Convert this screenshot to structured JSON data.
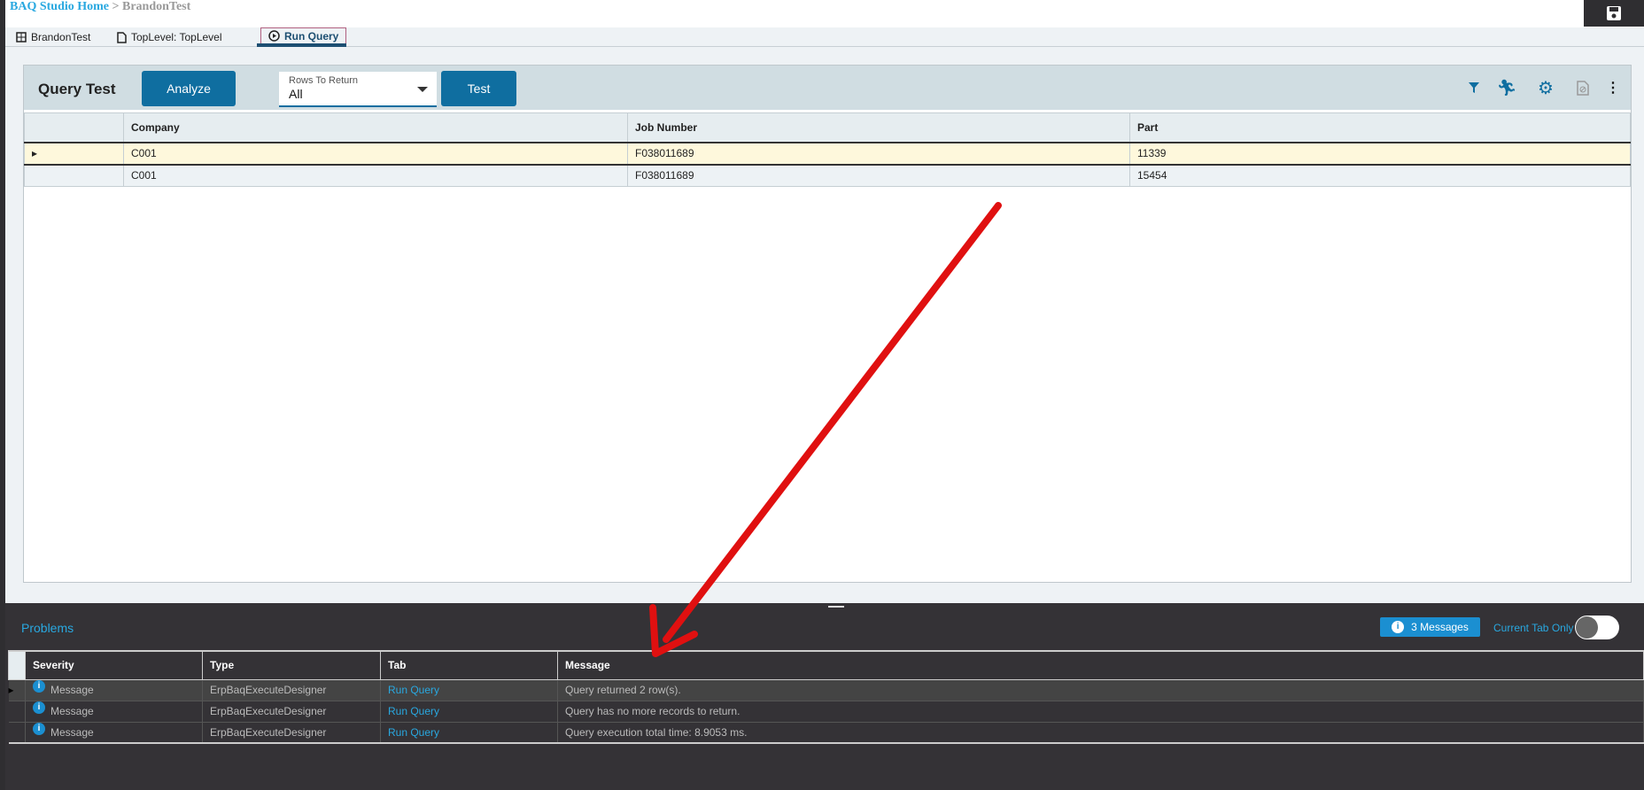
{
  "breadcrumb": {
    "home": "BAQ Studio Home",
    "separator": ">",
    "current": "BrandonTest"
  },
  "tabs": [
    {
      "label": "BrandonTest",
      "icon": "table-icon"
    },
    {
      "label": "TopLevel: TopLevel",
      "icon": "document-icon"
    },
    {
      "label": "Run Query",
      "icon": "play-circle-icon",
      "active": true
    }
  ],
  "query_panel": {
    "title": "Query Test",
    "analyze_label": "Analyze",
    "rows_label": "Rows To Return",
    "rows_value": "All",
    "test_label": "Test",
    "columns": [
      "Company",
      "Job Number",
      "Part"
    ],
    "rows": [
      [
        "C001",
        "F038011689",
        "11339"
      ],
      [
        "C001",
        "F038011689",
        "15454"
      ]
    ]
  },
  "problems": {
    "title": "Problems",
    "messages_label": "3 Messages",
    "current_tab_label": "Current Tab Only",
    "current_tab_on": false,
    "columns": [
      "Severity",
      "Type",
      "Tab",
      "Message"
    ],
    "rows": [
      [
        "Message",
        "ErpBaqExecuteDesigner",
        "Run Query",
        "Query returned 2 row(s)."
      ],
      [
        "Message",
        "ErpBaqExecuteDesigner",
        "Run Query",
        "Query has no more records to return."
      ],
      [
        "Message",
        "ErpBaqExecuteDesigner",
        "Run Query",
        "Query execution total time: 8.9053 ms."
      ]
    ]
  },
  "colors": {
    "accent": "#0f6ea0",
    "link": "#29a8e0",
    "annotation_arrow": "#e01010"
  }
}
